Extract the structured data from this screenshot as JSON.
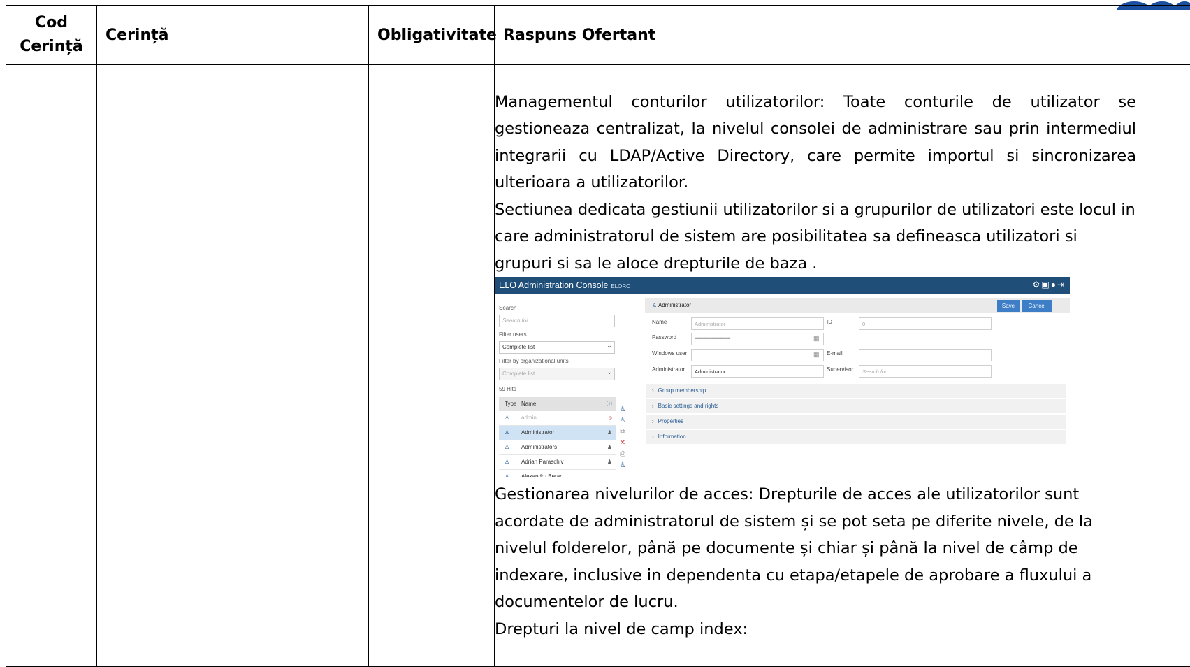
{
  "colors": {
    "console_bar": "#1f4e79",
    "accent": "#3d7ec7",
    "selected_row": "#cfe3f5"
  },
  "table": {
    "headers": [
      "Cod\nCerință",
      "Cerință",
      "Obligativitate",
      "Raspuns Ofertant"
    ],
    "response": {
      "p1": "Managementul conturilor utilizatorilor: Toate conturile de utilizator se gestioneaza centralizat, la nivelul consolei de administrare sau prin intermediul integrarii cu LDAP/Active Directory, care permite importul si sincronizarea ulterioara a utilizatorilor.",
      "p2": "Sectiunea dedicata gestiunii utilizatorilor si a grupurilor de utilizatori este locul in care administratorul de sistem are posibilitatea sa defineasca utilizatori si grupuri si sa le aloce drepturile de baza .",
      "p3": "Gestionarea nivelurilor de acces: Drepturile de acces ale utilizatorilor sunt acordate de administratorul de sistem și se pot seta pe diferite nivele, de la nivelul folderelor, până pe documente și chiar și până la nivel de câmp de indexare, inclusive in dependenta cu etapa/etapele de aprobare a fluxului a documentelor de lucru.",
      "p4": "Drepturi la nivel de camp index:"
    }
  },
  "screenshot": {
    "title": "ELO Administration Console",
    "subtitle": "ELORO",
    "toolbar_icons": [
      "gear-icon",
      "window-icon",
      "help-icon",
      "logout-icon"
    ],
    "left": {
      "search_label": "Search",
      "search_placeholder": "Search for",
      "filter_users_label": "Filter users",
      "filter_users_value": "Complete list",
      "filter_org_label": "Filter by organizational units",
      "filter_org_value": "Complete list",
      "hits": "59 Hits",
      "col_type": "Type",
      "col_name": "Name",
      "rows": [
        "admin",
        "Administrator",
        "Administrators",
        "Adrian Paraschiv",
        "Alexandru Berar"
      ]
    },
    "right": {
      "header_title": "Administrator",
      "save": "Save",
      "cancel": "Cancel",
      "name_label": "Name",
      "name_placeholder": "Administrator",
      "id_label": "ID",
      "id_placeholder": "0",
      "password_label": "Password",
      "password_value": "••••••••••••••••••••••••••••••••••••••••••••••",
      "windows_user_label": "Windows user",
      "email_label": "E-mail",
      "administrator_label": "Administrator",
      "administrator_value": "Administrator",
      "supervisor_label": "Supervisor",
      "supervisor_placeholder": "Search for",
      "sections": [
        "Group membership",
        "Basic settings and rights",
        "Properties",
        "Information"
      ]
    }
  }
}
